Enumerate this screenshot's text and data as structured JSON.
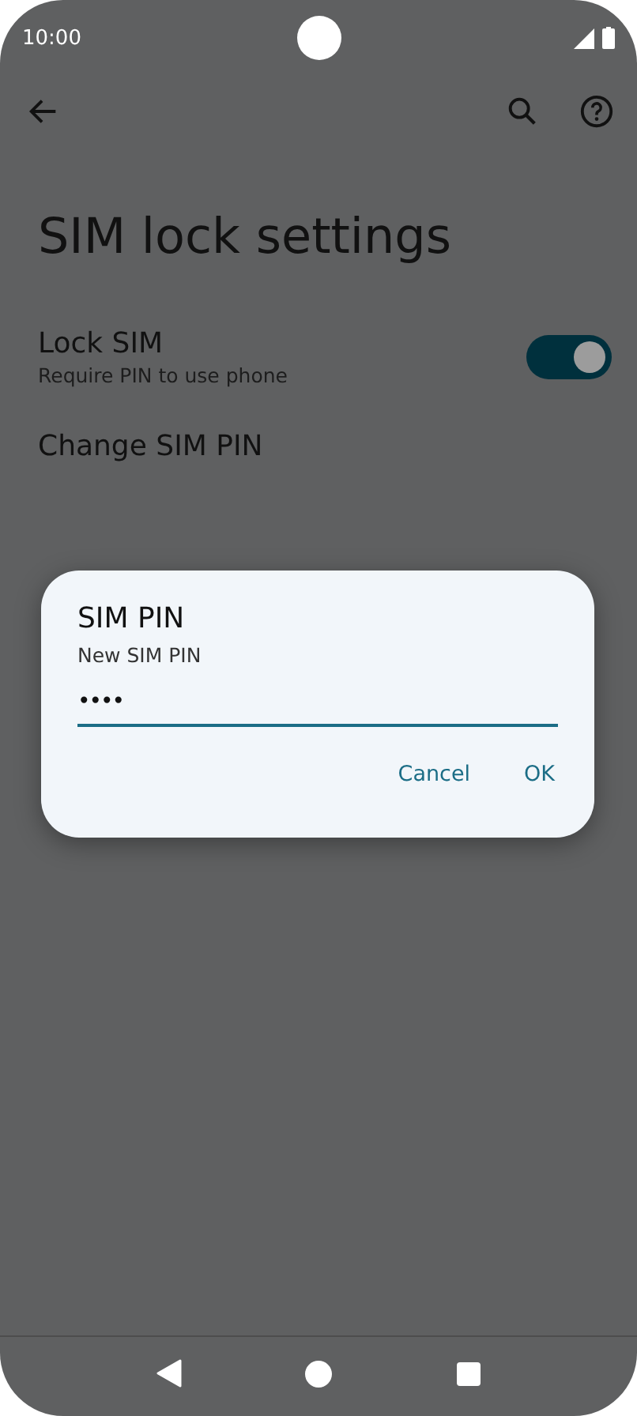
{
  "status_bar": {
    "time": "10:00"
  },
  "title": "SIM lock settings",
  "settings": [
    {
      "kind": "toggle",
      "title": "Lock SIM",
      "subtitle": "Require PIN to use phone",
      "on": true
    },
    {
      "kind": "plain",
      "title": "Change SIM PIN"
    }
  ],
  "dialog": {
    "title": "SIM PIN",
    "message": "New SIM PIN",
    "value": "••••",
    "buttons": [
      "Cancel",
      "OK"
    ]
  }
}
